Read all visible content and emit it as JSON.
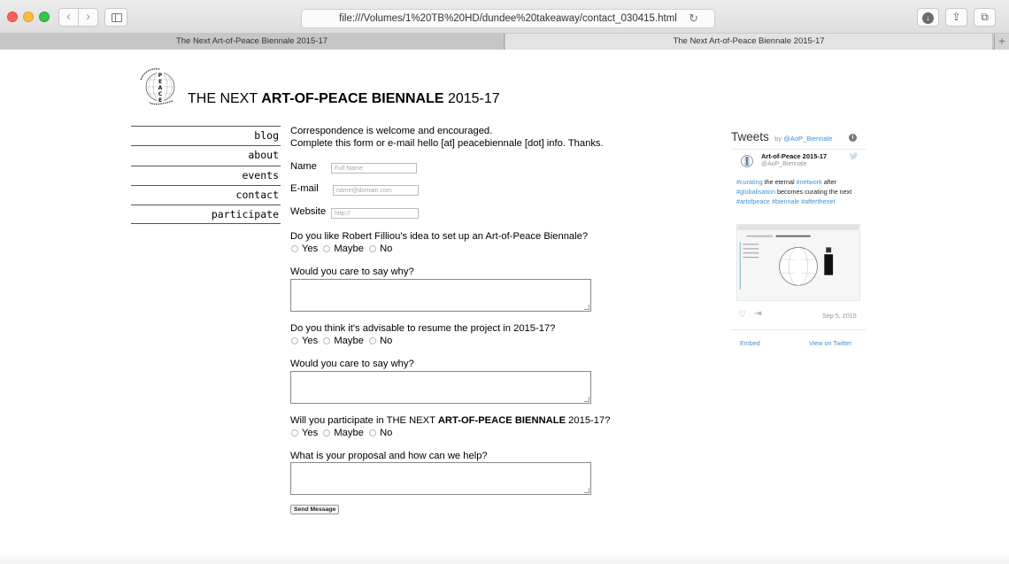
{
  "browser": {
    "url": "file:///Volumes/1%20TB%20HD/dundee%20takeaway/contact_030415.html",
    "back_icon": "‹",
    "forward_icon": "›",
    "reload_icon": "↻",
    "download_icon": "↓",
    "share_icon": "⇪",
    "tabs_icon": "⧉",
    "new_tab_icon": "+",
    "tabs": [
      {
        "label": "The Next Art-of-Peace Biennale 2015-17"
      },
      {
        "label": "The Next Art-of-Peace Biennale 2015-17"
      }
    ]
  },
  "header": {
    "title_prefix": "THE NEXT ",
    "title_bold": "ART-OF-PEACE BIENNALE",
    "title_suffix": " 2015-17"
  },
  "nav": {
    "items": [
      {
        "label": "blog"
      },
      {
        "label": "about"
      },
      {
        "label": "events"
      },
      {
        "label": "contact"
      },
      {
        "label": "participate"
      }
    ]
  },
  "form": {
    "intro_line1": "Correspondence is welcome and encouraged.",
    "intro_line2": "Complete this form or e-mail hello [at] peacebiennale [dot] info. Thanks.",
    "name_label": "Name",
    "name_placeholder": "Full Name",
    "email_label": "E-mail",
    "email_placeholder": "name@domain.com",
    "website_label": "Website",
    "website_placeholder": "http://",
    "q1": "Do you like Robert Filliou's idea to set up an Art-of-Peace Biennale?",
    "why_label": "Would you care to say why?",
    "q2": "Do you think it's advisable to resume the project in 2015-17?",
    "q3_prefix": "Will you participate in THE NEXT ",
    "q3_bold": "ART-OF-PEACE BIENNALE",
    "q3_suffix": " 2015-17?",
    "proposal_label": "What is your proposal and how can we help?",
    "options": {
      "yes": "Yes",
      "maybe": "Maybe",
      "no": "No"
    },
    "send_label": "Send Message"
  },
  "tweets": {
    "title": "Tweets",
    "by": "by",
    "account_link": "@AoP_Biennale",
    "info_icon": "i",
    "author_name": "Art-of-Peace 2015-17",
    "author_handle": "@AoP_Biennale",
    "text_1": "#curating",
    "text_2": " the eternal ",
    "text_3": "#network",
    "text_4": " after ",
    "text_5": "#globalisation",
    "text_6": " becomes curating the next ",
    "text_7": "#artofpeace",
    "text_8": " ",
    "text_9": "#biennale",
    "text_10": " ",
    "text_11": "#afterthenet",
    "heart_icon": "♡",
    "share_icon": "⇥",
    "date": "Sep 5, 2015",
    "embed": "Embed",
    "view": "View on Twitter"
  }
}
